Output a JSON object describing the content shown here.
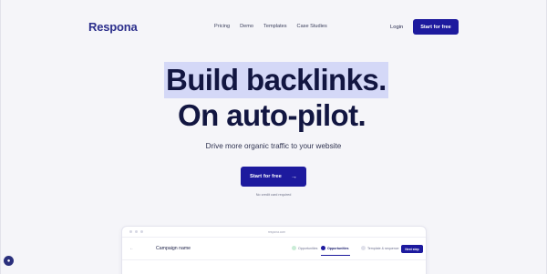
{
  "brand": {
    "logo": "Respona"
  },
  "nav": {
    "items": [
      "Pricing",
      "Demo",
      "Templates",
      "Case Studies"
    ],
    "login": "Login",
    "cta": "Start for free"
  },
  "hero": {
    "line1": "Build backlinks.",
    "line2": "On auto-pilot.",
    "subtitle": "Drive more organic traffic to your website",
    "cta": "Start for free",
    "cta_arrow": "→",
    "note": "No credit card required"
  },
  "preview": {
    "url": "respona.com",
    "campaign": "Campaign name",
    "steps": [
      "Opportunities",
      "Opportunities",
      "Template & sequence"
    ],
    "next": "Next step"
  }
}
